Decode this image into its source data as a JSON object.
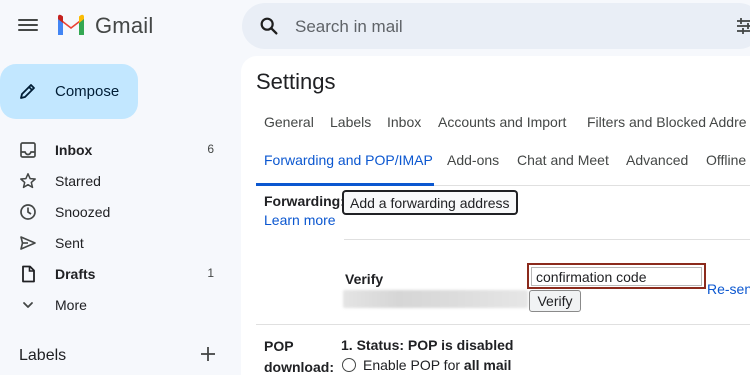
{
  "app": {
    "name": "Gmail"
  },
  "search": {
    "placeholder": "Search in mail"
  },
  "compose": {
    "label": "Compose"
  },
  "nav": {
    "items": [
      {
        "label": "Inbox",
        "count": "6",
        "icon": "inbox-icon"
      },
      {
        "label": "Starred",
        "count": "",
        "icon": "star-icon"
      },
      {
        "label": "Snoozed",
        "count": "",
        "icon": "clock-icon"
      },
      {
        "label": "Sent",
        "count": "",
        "icon": "send-icon"
      },
      {
        "label": "Drafts",
        "count": "1",
        "icon": "draft-icon"
      },
      {
        "label": "More",
        "count": "",
        "icon": "chevron-down-icon"
      }
    ],
    "labels_header": "Labels"
  },
  "settings": {
    "title": "Settings",
    "tabs_row1": [
      "General",
      "Labels",
      "Inbox",
      "Accounts and Import",
      "Filters and Blocked Addre"
    ],
    "tabs_row2": [
      "Forwarding and POP/IMAP",
      "Add-ons",
      "Chat and Meet",
      "Advanced",
      "Offline"
    ],
    "active_tab": "Forwarding and POP/IMAP",
    "forwarding": {
      "label": "Forwarding:",
      "learn_more": "Learn more",
      "add_button": "Add a forwarding address",
      "verify_label": "Verify",
      "code_value": "confirmation code",
      "verify_button": "Verify",
      "resend_link": "Re-sen"
    },
    "pop": {
      "label_line1": "POP",
      "label_line2": "download:",
      "status": "1. Status: POP is disabled",
      "option_prefix": "Enable POP for ",
      "option_bold": "all mail"
    }
  },
  "colors": {
    "accent": "#0b57d0",
    "compose_bg": "#c2e7ff",
    "highlight_box": "#8b2a1c",
    "page_bg": "#f6f8fc"
  }
}
